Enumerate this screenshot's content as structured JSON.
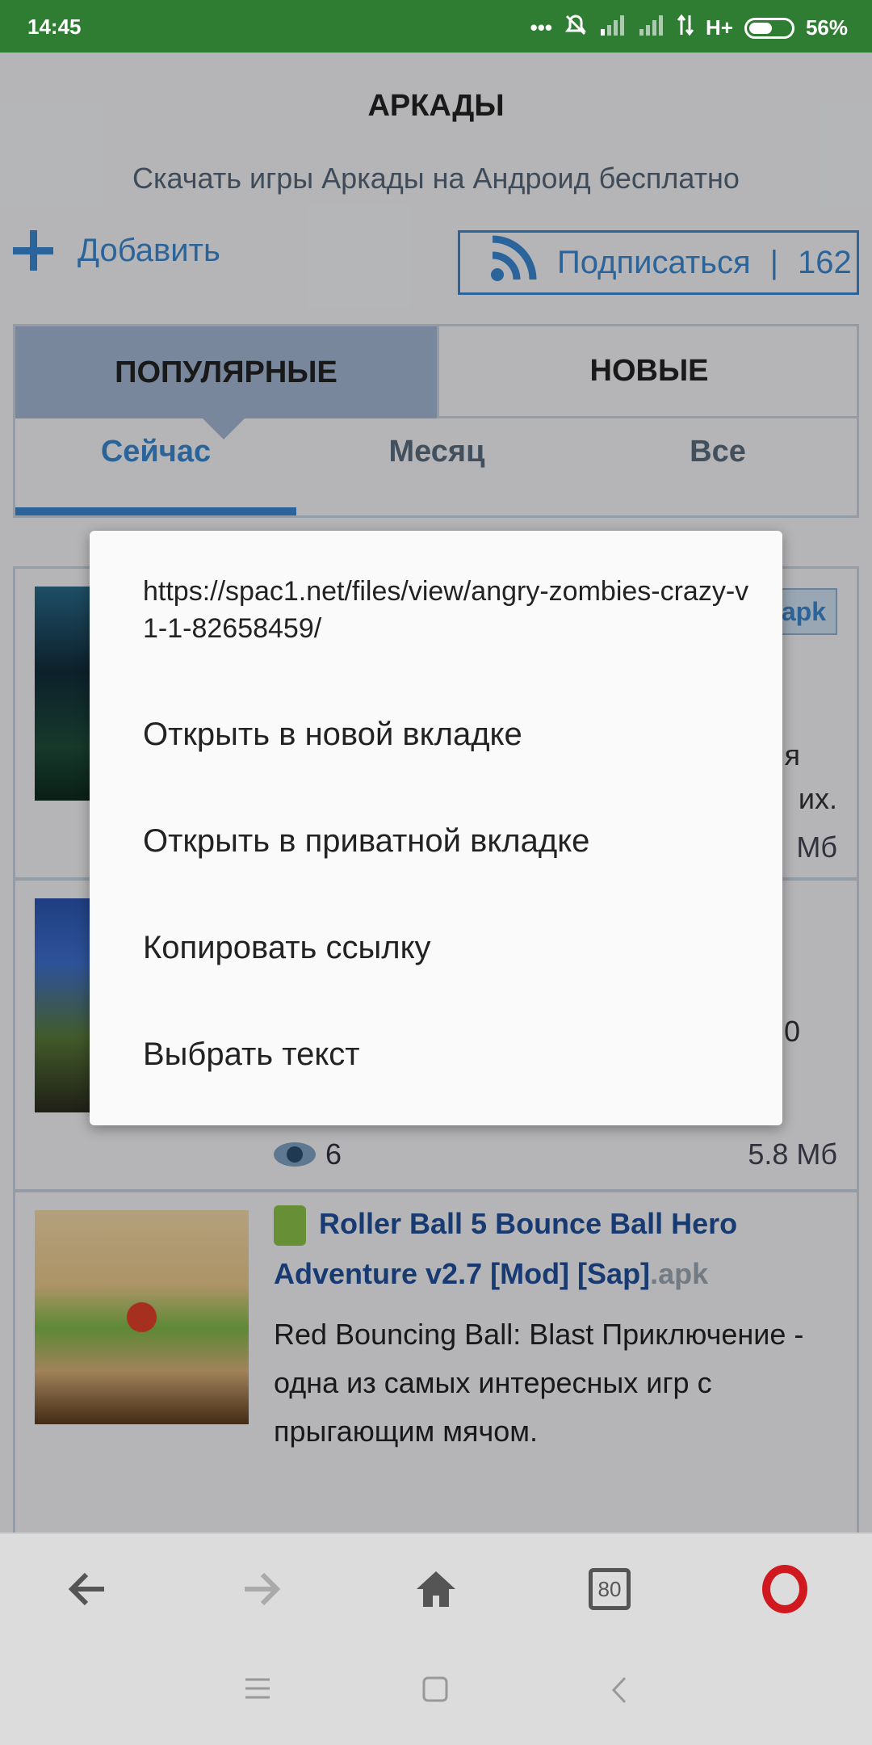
{
  "status_bar": {
    "time": "14:45",
    "network": "H+",
    "battery": "56%",
    "battery_level": 0.56,
    "icons": [
      "more-icon",
      "mute-icon",
      "signal-icon",
      "signal-icon",
      "data-arrows-icon"
    ]
  },
  "header": {
    "title": "АРКАДЫ",
    "subtitle": "Скачать игры Аркады на Андроид бесплатно",
    "add_label": "Добавить",
    "subscribe_label": "Подписаться",
    "subscribe_count": "162"
  },
  "tabs": {
    "main": [
      "ПОПУЛЯРНЫЕ",
      "НОВЫЕ"
    ],
    "sub": [
      "Сейчас",
      "Месяц",
      "Все"
    ]
  },
  "list": {
    "item1": {
      "badge": "apk",
      "desc_partial_1": "я",
      "desc_partial_2": "их.",
      "size_partial": "Мб"
    },
    "item2": {
      "partial_char": "0",
      "views": "6",
      "size": "5.8 Мб"
    },
    "item3": {
      "title": "Roller Ball 5 Bounce Ball Hero Adventure v2.7 [Mod] [Sap]",
      "ext": ".apk",
      "description": "Red Bouncing Ball: Blast Приключение - одна из самых интересных игр с прыгающим мячом."
    }
  },
  "context_menu": {
    "url": "https://spac1.net/files/view/angry-zombies-crazy-v1-1-82658459/",
    "items": [
      "Открыть в новой вкладке",
      "Открыть в приватной вкладке",
      "Копировать ссылку",
      "Выбрать текст"
    ]
  },
  "toolbar": {
    "tab_count": "80"
  },
  "colors": {
    "status_bar": "#2e7d32",
    "accent": "#3a87d0",
    "tab_active": "#a3b7d3",
    "opera_red": "#d0191e"
  }
}
